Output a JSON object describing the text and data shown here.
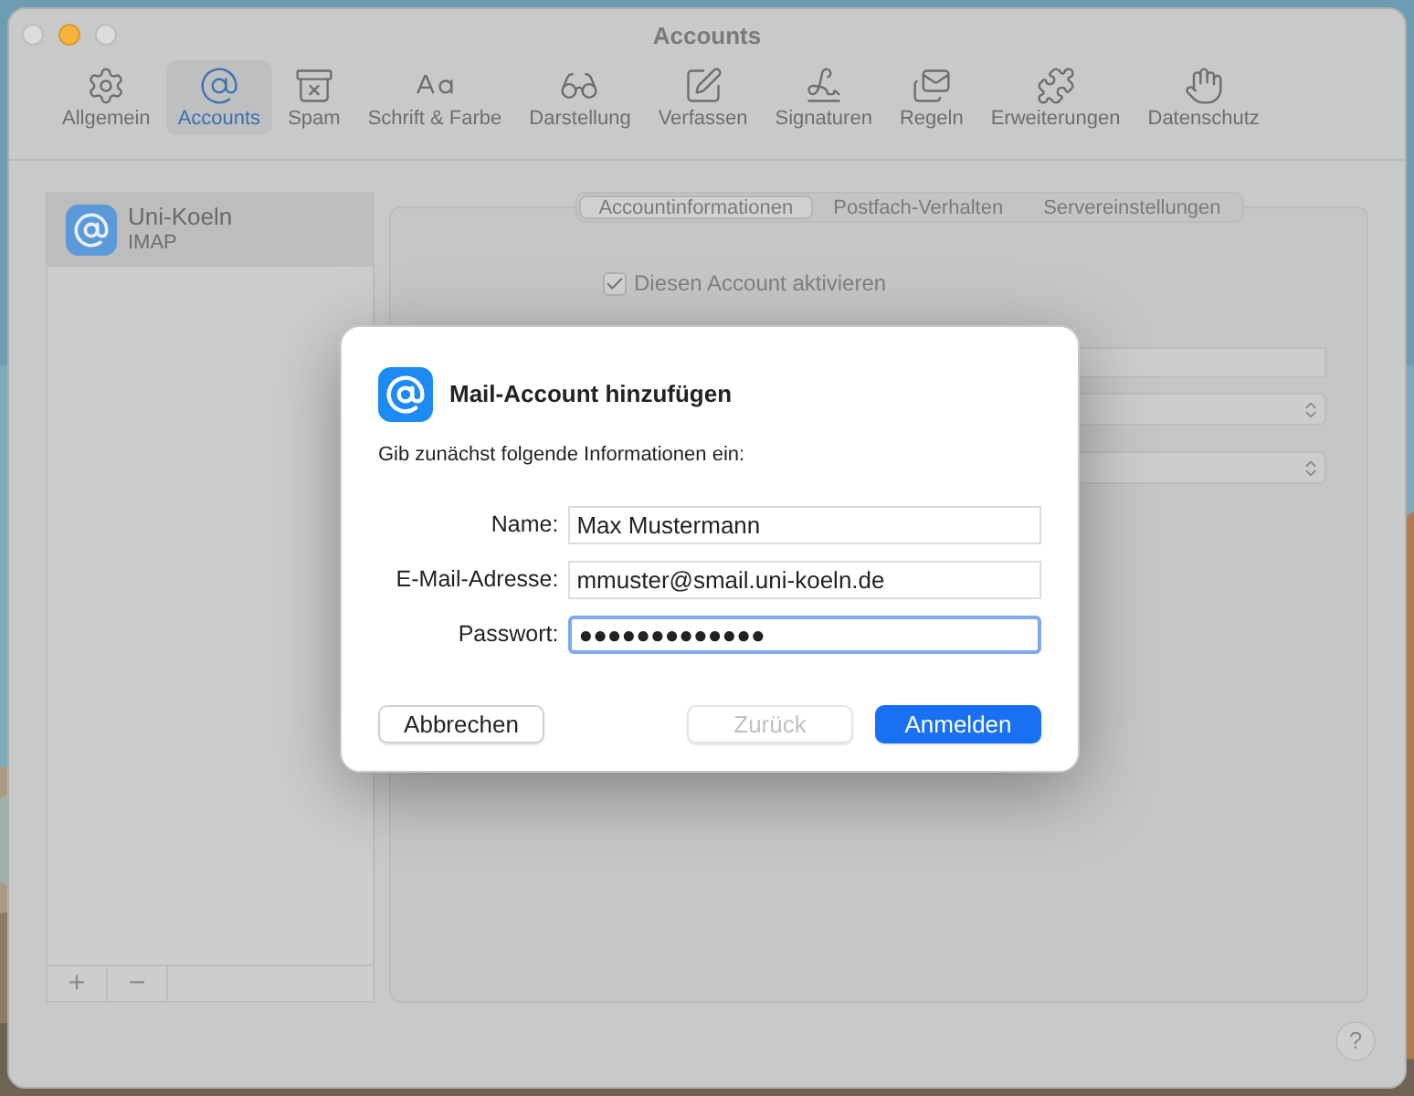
{
  "window": {
    "title": "Accounts"
  },
  "toolbar": [
    {
      "label": "Allgemein",
      "kind": "gear",
      "selected": false
    },
    {
      "label": "Accounts",
      "kind": "at",
      "selected": true
    },
    {
      "label": "Spam",
      "kind": "spam",
      "selected": false
    },
    {
      "label": "Schrift & Farbe",
      "kind": "font",
      "selected": false
    },
    {
      "label": "Darstellung",
      "kind": "glasses",
      "selected": false
    },
    {
      "label": "Verfassen",
      "kind": "compose",
      "selected": false
    },
    {
      "label": "Signaturen",
      "kind": "signature",
      "selected": false
    },
    {
      "label": "Regeln",
      "kind": "rules",
      "selected": false
    },
    {
      "label": "Erweiterungen",
      "kind": "puzzle",
      "selected": false
    },
    {
      "label": "Datenschutz",
      "kind": "hand",
      "selected": false
    }
  ],
  "sidebar": {
    "accounts": [
      {
        "name": "Uni-Koeln",
        "type": "IMAP",
        "selected": true
      }
    ],
    "add_button": "+",
    "remove_button": "−"
  },
  "account_panel": {
    "tabs": [
      {
        "label": "Accountinformationen",
        "selected": true
      },
      {
        "label": "Postfach-Verhalten",
        "selected": false
      },
      {
        "label": "Servereinstellungen",
        "selected": false
      }
    ],
    "enable_checkbox": {
      "label": "Diesen Account aktivieren",
      "checked": true
    }
  },
  "dialog": {
    "title": "Mail-Account hinzufügen",
    "intro": "Gib zunächst folgende Informationen ein:",
    "fields": [
      {
        "label": "Name:",
        "value": "Max Mustermann",
        "focused": false
      },
      {
        "label": "E-Mail-Adresse:",
        "value": "mmuster@smail.uni-koeln.de",
        "focused": false
      },
      {
        "label": "Passwort:",
        "value": "●●●●●●●●●●●●●",
        "focused": true
      }
    ],
    "buttons": [
      {
        "label": "Abbrechen",
        "kind": "normal"
      },
      {
        "label": "Zurück",
        "kind": "disabled"
      },
      {
        "label": "Anmelden",
        "kind": "primary"
      }
    ]
  },
  "help_button": "?"
}
